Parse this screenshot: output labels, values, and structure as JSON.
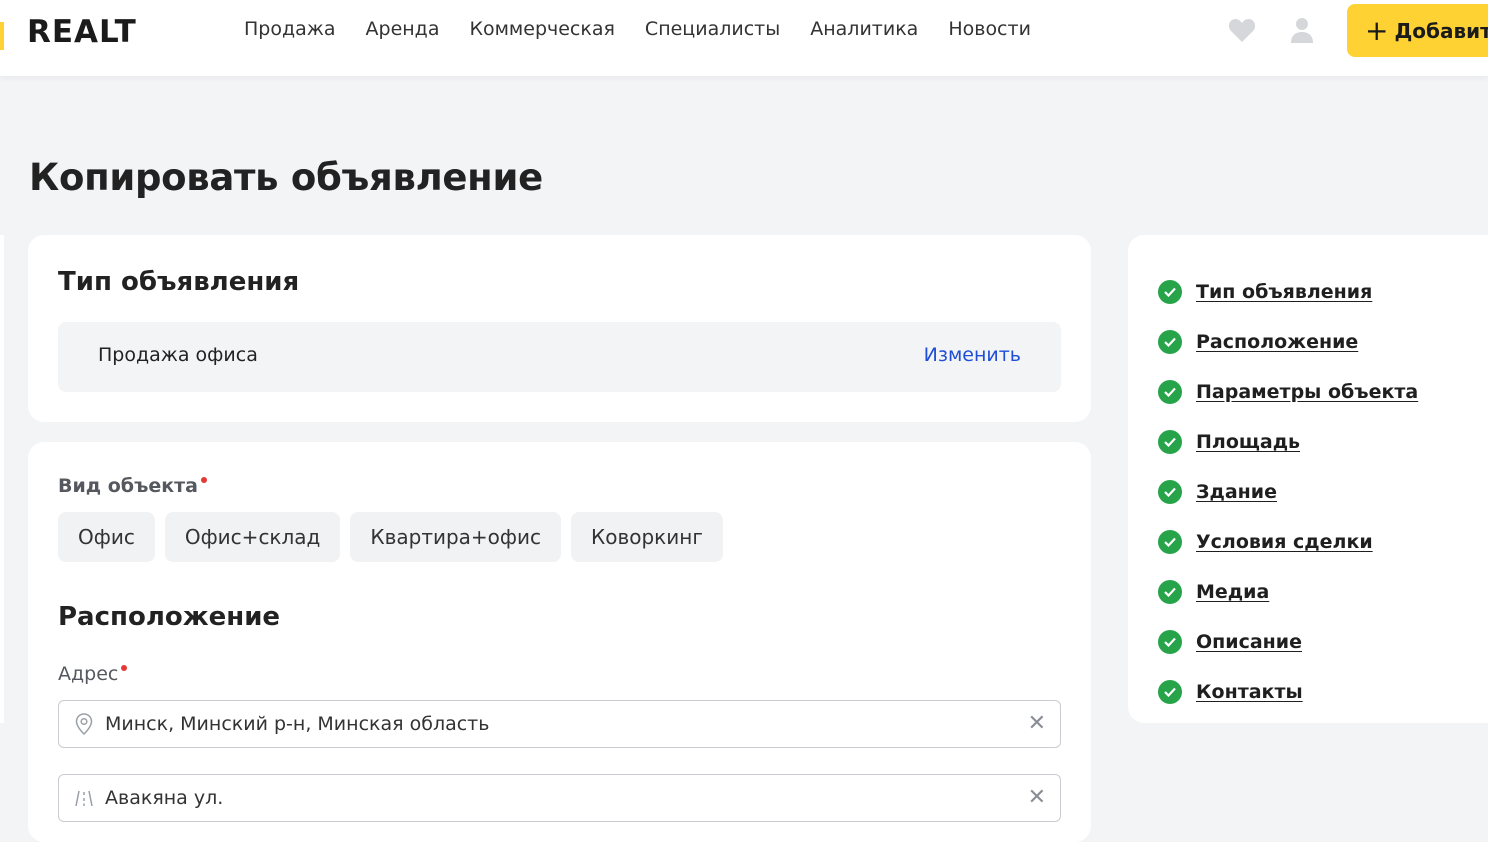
{
  "header": {
    "logo": "REALT",
    "nav": [
      "Продажа",
      "Аренда",
      "Коммерческая",
      "Специалисты",
      "Аналитика",
      "Новости"
    ],
    "add_label": "Добавить"
  },
  "page": {
    "title": "Копировать объявление"
  },
  "type_section": {
    "title": "Тип объявления",
    "value": "Продажа офиса",
    "change_label": "Изменить"
  },
  "object_section": {
    "label": "Вид объекта",
    "options": [
      "Офис",
      "Офис+склад",
      "Квартира+офис",
      "Коворкинг"
    ]
  },
  "location_section": {
    "title": "Расположение",
    "address_label": "Адрес",
    "address_value": "Минск, Минский р-н, Минская область",
    "street_value": "Авакяна ул."
  },
  "sidebar": {
    "items": [
      "Тип объявления",
      "Расположение",
      "Параметры объекта",
      "Площадь",
      "Здание",
      "Условия сделки",
      "Медиа",
      "Описание",
      "Контакты"
    ]
  },
  "colors": {
    "accent": "#ffd233",
    "link": "#1e4fd6",
    "check": "#27a34a",
    "required": "#e53935"
  }
}
